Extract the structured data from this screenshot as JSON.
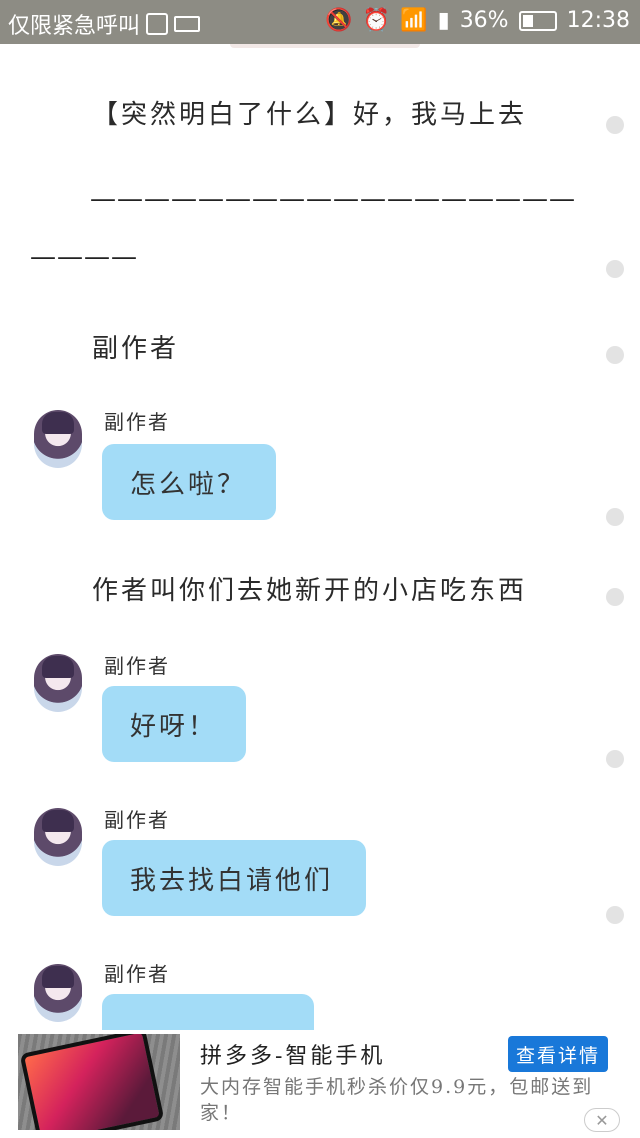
{
  "statusbar": {
    "carrier_text": "仅限紧急呼叫",
    "battery_percent": "36%",
    "battery_level": 0.36,
    "time": "12:38",
    "icons": [
      "image-icon",
      "keyboard-icon",
      "mute-icon",
      "alarm-icon",
      "wifi-icon",
      "sim-icon",
      "battery-icon"
    ]
  },
  "story": {
    "line1": "【突然明白了什么】好，我马上去",
    "dashes1": "——————————————————",
    "dashes2": "————",
    "narration_label": "副作者",
    "narration2": "作者叫你们去她新开的小店吃东西"
  },
  "messages": [
    {
      "sender": "副作者",
      "text": "怎么啦？"
    },
    {
      "sender": "副作者",
      "text": "好呀！"
    },
    {
      "sender": "副作者",
      "text": "我去找白请他们"
    },
    {
      "sender": "副作者",
      "text": "…"
    }
  ],
  "ad": {
    "title": "拼多多-智能手机",
    "description": "大内存智能手机秒杀价仅9.9元，包邮送到家！",
    "button_label": "查看详情",
    "close_label": "✕"
  }
}
